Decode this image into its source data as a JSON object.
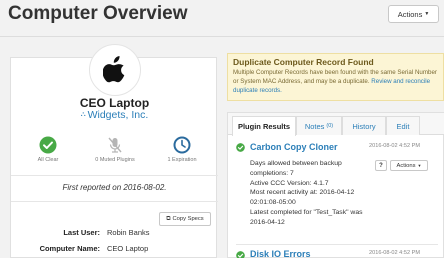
{
  "header": {
    "title": "Computer Overview",
    "actions_label": "Actions"
  },
  "computer": {
    "name": "CEO Laptop",
    "organization": "Widgets, Inc.",
    "stats": [
      {
        "label": "All Clear",
        "icon": "check-circle-icon",
        "color": "#48a946"
      },
      {
        "label": "0 Muted Plugins",
        "icon": "muted-microphone-icon",
        "color": "#b5b5b5"
      },
      {
        "label": "1 Expiration",
        "icon": "clock-icon",
        "color": "#2b6b9e"
      }
    ],
    "first_reported": "First reported on 2016-08-02.",
    "copy_specs_label": "Copy Specs",
    "details": [
      {
        "label": "Last User:",
        "value": "Robin Banks"
      },
      {
        "label": "Computer Name:",
        "value": "CEO Laptop"
      }
    ]
  },
  "alert": {
    "title": "Duplicate Computer Record Found",
    "body": "Multiple Computer Records have been found with the same Serial Number or System MAC Address, and may be a duplicate.",
    "link_text": "Review and reconcile duplicate records."
  },
  "plugin_panel": {
    "tabs": [
      {
        "label": "Plugin Results",
        "count": ""
      },
      {
        "label": "Notes",
        "count": "(0)"
      },
      {
        "label": "History",
        "count": ""
      },
      {
        "label": "Edit",
        "count": ""
      }
    ],
    "results": [
      {
        "title": "Carbon Copy Cloner",
        "timestamp": "2016-08-02 4:52 PM",
        "lines": [
          "Days allowed between backup completions: 7",
          "Active CCC Version: 4.1.7",
          "Most recent activity at: 2016-04-12 02:01:08-05:00",
          "Latest completed for \"Test_Task\" was 2016-04-12"
        ],
        "help_label": "?",
        "actions_label": "Actions"
      },
      {
        "title": "Disk IO Errors",
        "timestamp": "2016-08-02 4:52 PM"
      }
    ]
  },
  "colors": {
    "link": "#2c7fb8",
    "success": "#48a946",
    "alert_bg": "#fcf5d5"
  }
}
